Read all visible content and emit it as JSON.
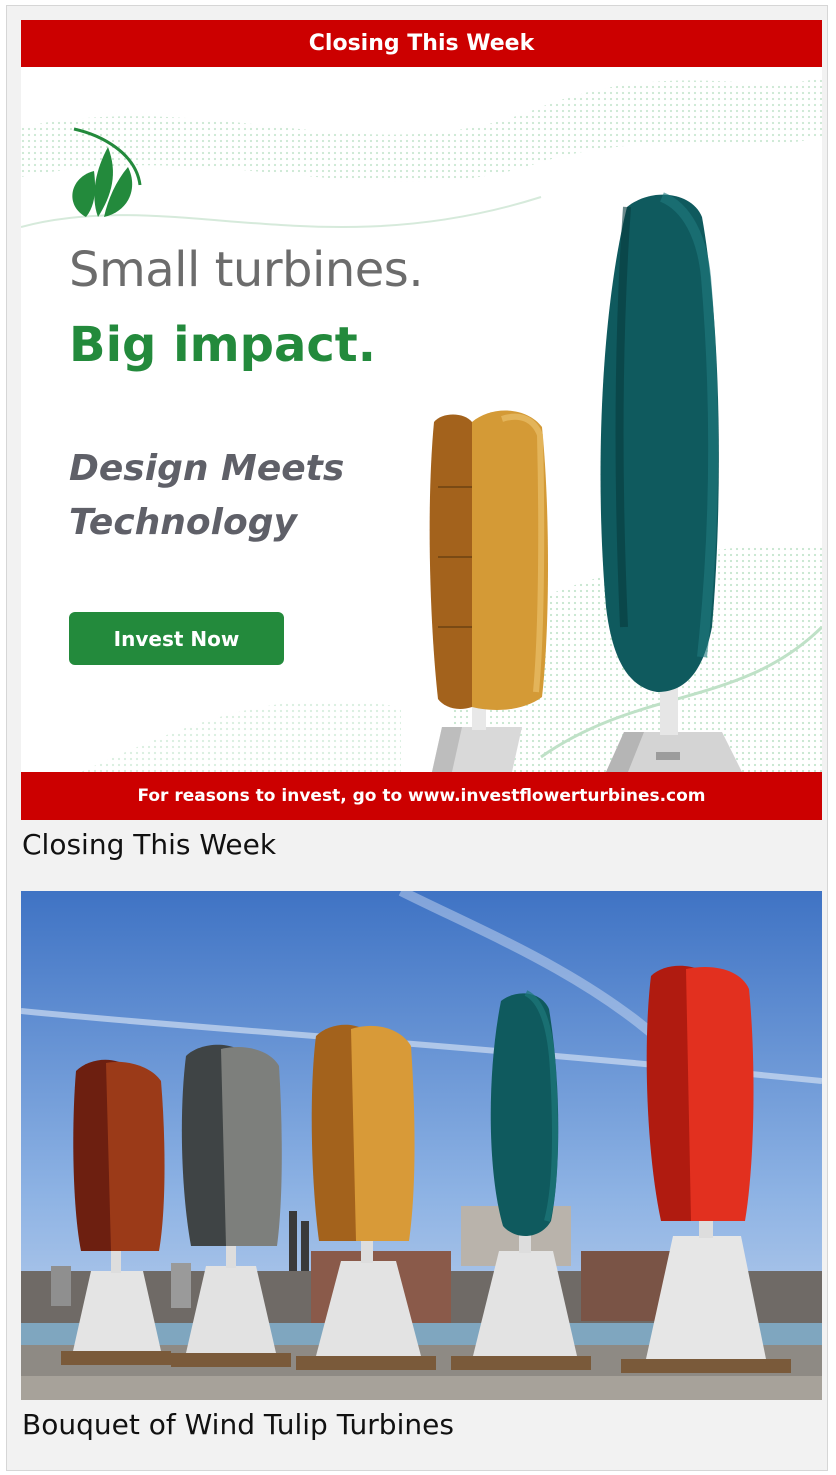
{
  "ad": {
    "top_banner": "Closing This Week",
    "headline_line1": "Small turbines.",
    "headline_line2": "Big impact.",
    "tagline": "Design Meets Technology",
    "cta_label": "Invest Now",
    "bottom_banner": "For reasons to invest, go to www.investflowerturbines.com",
    "colors": {
      "banner_red": "#cc0000",
      "brand_green": "#238a3c",
      "headline_gray": "#6c6c6c"
    },
    "logo_icon": "leaf-logo-icon"
  },
  "captions": {
    "first": "Closing This Week",
    "second": "Bouquet of Wind Tulip Turbines"
  },
  "photo": {
    "turbine_colors": [
      "#8a2a12",
      "#8c8c8a",
      "#e0a33a",
      "#0f5a5e",
      "#e0281c"
    ]
  }
}
